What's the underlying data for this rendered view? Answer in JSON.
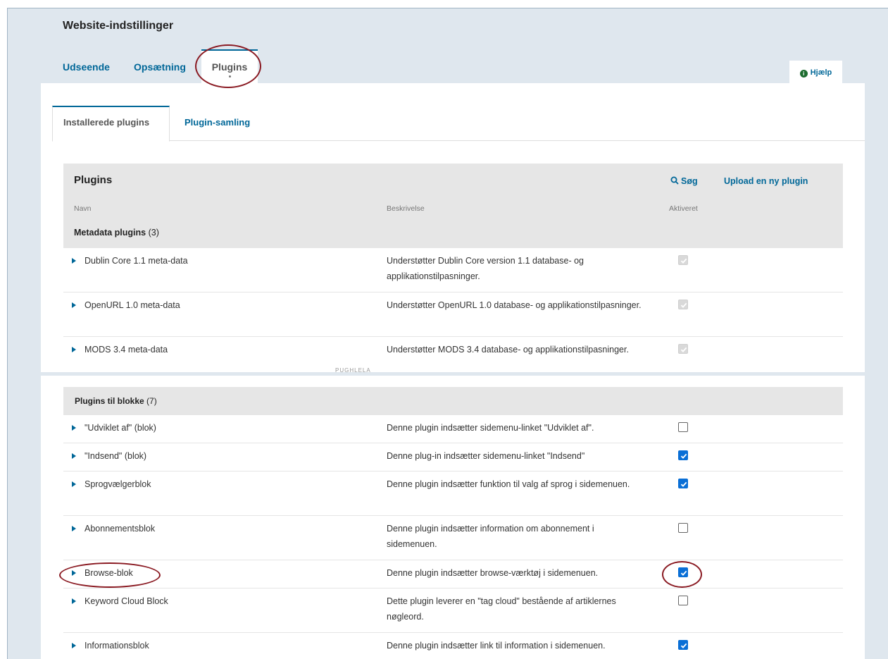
{
  "page": {
    "title": "Website-indstillinger"
  },
  "top_tabs": [
    {
      "label": "Udseende"
    },
    {
      "label": "Opsætning"
    },
    {
      "label": "Plugins"
    }
  ],
  "help": {
    "label": "Hjælp",
    "icon": "info-icon"
  },
  "sub_tabs": [
    {
      "label": "Installerede plugins"
    },
    {
      "label": "Plugin-samling"
    }
  ],
  "grid": {
    "title": "Plugins",
    "search_label": "Søg",
    "upload_label": "Upload en ny plugin",
    "columns": {
      "name": "Navn",
      "description": "Beskrivelse",
      "enabled": "Aktiveret"
    }
  },
  "metadata_category": {
    "title": "Metadata plugins",
    "count": "(3)",
    "rows": [
      {
        "name": "Dublin Core 1.1 meta-data",
        "description": "Understøtter Dublin Core version 1.1 database- og applikationstilpasninger.",
        "enabled": true,
        "disabled": true
      },
      {
        "name": "OpenURL 1.0 meta-data",
        "description": "Understøtter OpenURL 1.0 database- og applikationstilpasninger.",
        "enabled": true,
        "disabled": true
      },
      {
        "name": "MODS 3.4 meta-data",
        "description": "Understøtter MODS 3.4 database- og applikationstilpasninger.",
        "enabled": true,
        "disabled": true
      }
    ]
  },
  "cut_fragment": "PUGHLELA",
  "block_category": {
    "title": "Plugins til blokke",
    "count": "(7)",
    "rows": [
      {
        "name": "\"Udviklet af\" (blok)",
        "description": "Denne plugin indsætter sidemenu-linket \"Udviklet af\".",
        "enabled": false
      },
      {
        "name": "\"Indsend\" (blok)",
        "description": "Denne plug-in indsætter sidemenu-linket \"Indsend\"",
        "enabled": true
      },
      {
        "name": "Sprogvælgerblok",
        "description": "Denne plugin indsætter funktion til valg af sprog i sidemenuen.",
        "enabled": true
      },
      {
        "name": "Abonnementsblok",
        "description": "Denne plugin indsætter information om abonnement i sidemenuen.",
        "enabled": false
      },
      {
        "name": "Browse-blok",
        "description": "Denne plugin indsætter browse-værktøj i sidemenuen.",
        "enabled": true
      },
      {
        "name": "Keyword Cloud Block",
        "description": "Dette plugin leverer en \"tag cloud\" bestående af artiklernes nøgleord.",
        "enabled": false
      },
      {
        "name": "Informationsblok",
        "description": "Denne plugin indsætter link til information i sidemenuen.",
        "enabled": true
      }
    ]
  },
  "colors": {
    "accent": "#006798",
    "checkbox_on": "#0a6fd6",
    "annotation": "#8a1a22",
    "canvas": "#dfe7ee",
    "grid_header": "#e6e6e6"
  }
}
